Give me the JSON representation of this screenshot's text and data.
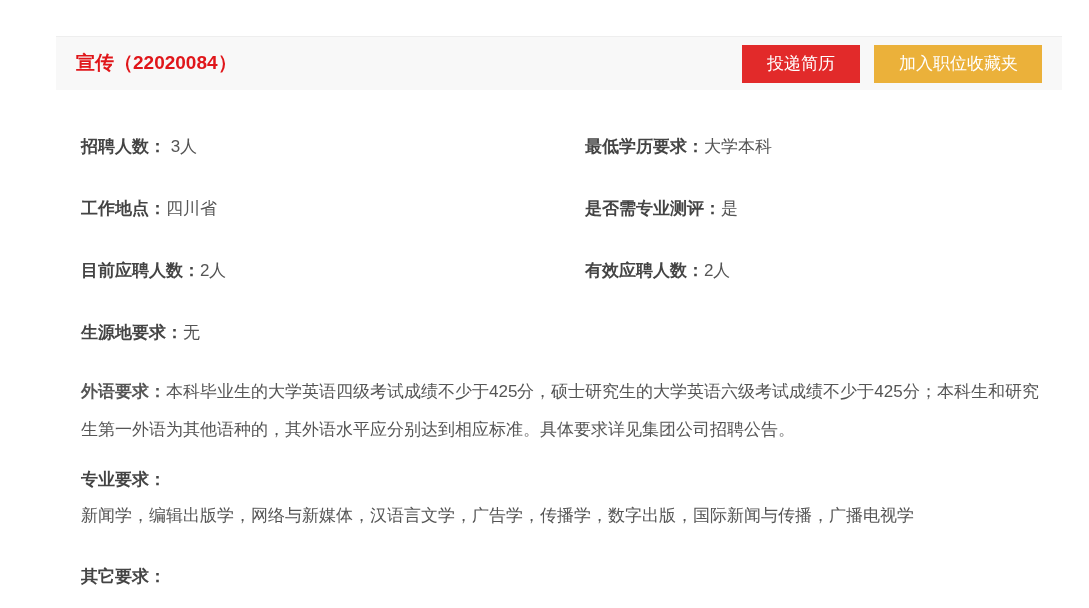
{
  "header": {
    "title": "宣传（22020084）",
    "buttons": [
      {
        "label": "投递简历",
        "kind": "primary"
      },
      {
        "label": "加入职位收藏夹",
        "kind": "secondary"
      }
    ]
  },
  "fields": [
    {
      "label": "招聘人数：",
      "value": " 3人"
    },
    {
      "label": "最低学历要求：",
      "value": "大学本科"
    },
    {
      "label": "工作地点：",
      "value": "四川省"
    },
    {
      "label": "是否需专业测评：",
      "value": "是"
    },
    {
      "label": "目前应聘人数：",
      "value": "2人"
    },
    {
      "label": "有效应聘人数：",
      "value": "2人"
    },
    {
      "label": "生源地要求：",
      "value": "无"
    }
  ],
  "language_requirement": "**外语要求：**本科毕业生的大学英语四级考试成绩不少于425分，硕士研究生的大学英语六级考试成绩不少于425分；本科生和研究生第一外语为其他语种的，其外语水平应分别达到相应标准。具体要求详见集团公司招聘公告。",
  "major_requirement": {
    "label": "专业要求：",
    "value": "新闻学，编辑出版学，网络与新媒体，汉语言文学，广告学，传播学，数字出版，国际新闻与传播，广播电视学"
  },
  "other_requirement": {
    "label": "其它要求："
  }
}
